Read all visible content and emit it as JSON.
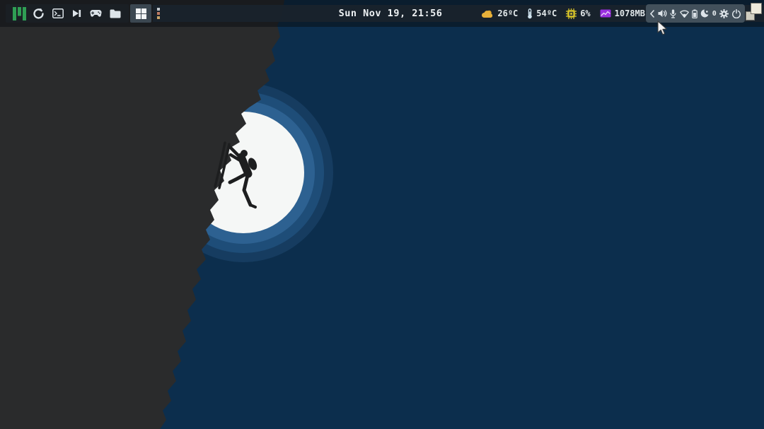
{
  "wallpaper": {
    "description": "silhouette of a rock climber on a dark cliff in front of a white moon with concentric blue rings",
    "sky_color": "#0c2e4d",
    "cliff_color": "#2a2b2c",
    "moon_color": "#f5f7f6",
    "ring_colors": [
      "#2d6191",
      "#1e4d78",
      "#163c60"
    ]
  },
  "panel": {
    "clock": "Sun Nov 19, 21:56",
    "launcher": {
      "items": [
        {
          "name": "manjaro-menu"
        },
        {
          "name": "updates"
        },
        {
          "name": "terminal"
        },
        {
          "name": "media-player"
        },
        {
          "name": "games"
        },
        {
          "name": "file-manager"
        }
      ]
    },
    "workspace": {
      "icon": "window-grid"
    },
    "menu_dots": {
      "icon": "vertical-ellipsis"
    },
    "stats": [
      {
        "name": "weather",
        "icon": "cloud-icon",
        "icon_color": "#e2a62c",
        "value": "26ºC"
      },
      {
        "name": "temperature",
        "icon": "thermometer-icon",
        "icon_color": "#cfe3ee",
        "value": "54ºC"
      },
      {
        "name": "cpu",
        "icon": "chip-icon",
        "icon_color": "#ddc928",
        "value": "6%"
      },
      {
        "name": "memory",
        "icon": "ram-chart-icon",
        "icon_color": "#9a2fe0",
        "value": "1078MB"
      }
    ],
    "tray": {
      "items": [
        "collapse-chevron",
        "volume",
        "microphone",
        "wifi",
        "battery",
        "night-light",
        "counter",
        "settings",
        "power"
      ],
      "counter": "0"
    },
    "show_desktop": {
      "icon": "overlapping-windows"
    }
  }
}
